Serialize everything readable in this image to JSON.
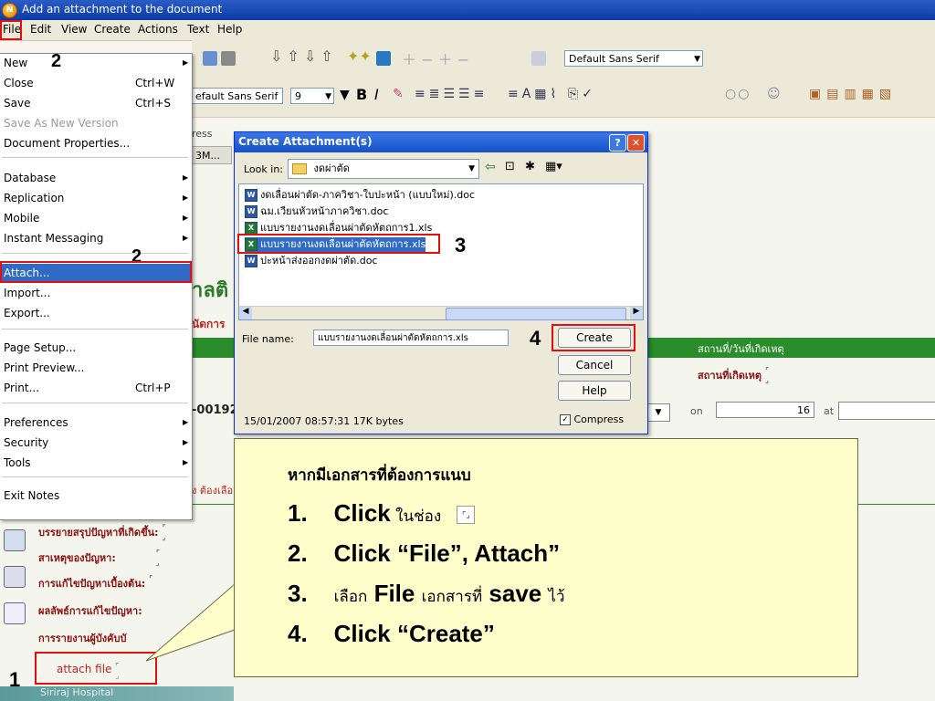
{
  "window": {
    "title": "Add an attachment to the document"
  },
  "menubar": [
    "File",
    "Edit",
    "View",
    "Create",
    "Actions",
    "Text",
    "Help"
  ],
  "toolbar": {
    "font_name": "Default Sans Serif",
    "font_name2": "efault Sans Serif",
    "font_size": "9",
    "bold": "B",
    "italic": "I"
  },
  "file_menu": {
    "items": [
      {
        "label": "New",
        "shortcut": "",
        "submenu": true,
        "disabled": false
      },
      {
        "label": "Close",
        "shortcut": "Ctrl+W",
        "submenu": false,
        "disabled": false
      },
      {
        "label": "Save",
        "shortcut": "Ctrl+S",
        "submenu": false,
        "disabled": false
      },
      {
        "label": "Save As New Version",
        "shortcut": "",
        "submenu": false,
        "disabled": true
      },
      {
        "label": "Document Properties...",
        "shortcut": "",
        "submenu": false,
        "disabled": false
      },
      {
        "label": "Database",
        "shortcut": "",
        "submenu": true,
        "disabled": false
      },
      {
        "label": "Replication",
        "shortcut": "",
        "submenu": true,
        "disabled": false
      },
      {
        "label": "Mobile",
        "shortcut": "",
        "submenu": true,
        "disabled": false
      },
      {
        "label": "Instant Messaging",
        "shortcut": "",
        "submenu": true,
        "disabled": false
      },
      {
        "label": "Attach...",
        "shortcut": "",
        "submenu": false,
        "disabled": false
      },
      {
        "label": "Import...",
        "shortcut": "",
        "submenu": false,
        "disabled": false
      },
      {
        "label": "Export...",
        "shortcut": "",
        "submenu": false,
        "disabled": false
      },
      {
        "label": "Page Setup...",
        "shortcut": "",
        "submenu": false,
        "disabled": false
      },
      {
        "label": "Print Preview...",
        "shortcut": "",
        "submenu": false,
        "disabled": false
      },
      {
        "label": "Print...",
        "shortcut": "Ctrl+P",
        "submenu": false,
        "disabled": false
      },
      {
        "label": "Preferences",
        "shortcut": "",
        "submenu": true,
        "disabled": false
      },
      {
        "label": "Security",
        "shortcut": "",
        "submenu": true,
        "disabled": false
      },
      {
        "label": "Tools",
        "shortcut": "",
        "submenu": true,
        "disabled": false
      },
      {
        "label": "Exit Notes",
        "shortcut": "",
        "submenu": false,
        "disabled": false
      }
    ]
  },
  "dialog": {
    "title": "Create Attachment(s)",
    "look_in_label": "Look in:",
    "look_in_value": "งดผ่าตัด",
    "files": [
      {
        "name": "งดเลื่อนผ่าตัด-ภาควิชา-ใบปะหน้า (แบบใหม่).doc",
        "type": "doc"
      },
      {
        "name": "ฉม.เวียนหัวหน้าภาควิชา.doc",
        "type": "doc"
      },
      {
        "name": "แบบรายงานงดเลื่อนผ่าตัดหัตถการ1.xls",
        "type": "xls"
      },
      {
        "name": "แบบรายงานงดเลื่อนผ่าตัดหัตถการ.xls",
        "type": "xls"
      },
      {
        "name": "ปะหน้าส่งออกงดผ่าตัด.doc",
        "type": "doc"
      }
    ],
    "file_name_label": "File name:",
    "file_name_value": "แบบรายงานงดเลื่อนผ่าตัดหัตถการ.xls",
    "create_label": "Create",
    "cancel_label": "Cancel",
    "help_label": "Help",
    "file_info": "15/01/2007 08:57:31 17K bytes",
    "compress_label": "Compress",
    "compress_checked": true,
    "help_btn": "?",
    "close_btn": "✕"
  },
  "form": {
    "ress_frag": "ress",
    "bm_frag": "3M...",
    "big_frag": "าลติ",
    "sub_frag": "นัดการ",
    "id_frag": "-00192",
    "red_frag": "ง ต้องเลือ",
    "header_right": "สถานที่/วันที่เกิดเหตุ",
    "place_label": "สถานที่เกิดเหตุ",
    "on_label": "on",
    "on_value": "16",
    "at_label": "at",
    "fields": [
      "บรรยายสรุปปัญหาที่เกิดขึ้น:",
      "สาเหตุของปัญหา:",
      "การแก้ไขปัญหาเบื้องต้น:",
      "ผลลัพธ์การแก้ไขปัญหา:",
      "การรายงานผู้บังคับบั"
    ],
    "attach_label": "attach file",
    "footer": "Siriraj Hospital"
  },
  "callout": {
    "intro": "หากมีเอกสารที่ต้องการแนบ",
    "steps": [
      {
        "num": "1.",
        "bold": "Click",
        "rest": " ในช่อง"
      },
      {
        "num": "2.",
        "bold": "Click “File”,  Attach”",
        "rest": ""
      },
      {
        "num": "3.",
        "bold": "",
        "rest": "เลือก"
      },
      {
        "num": "4.",
        "bold": "Click “Create”",
        "rest": ""
      }
    ],
    "step3_file": "File",
    "step3_mid": "เอกสารที่",
    "step3_save": "save",
    "step3_end": "ไว้"
  },
  "markers": {
    "m1": "1",
    "m2a": "2",
    "m2b": "2",
    "m3": "3",
    "m4": "4"
  }
}
